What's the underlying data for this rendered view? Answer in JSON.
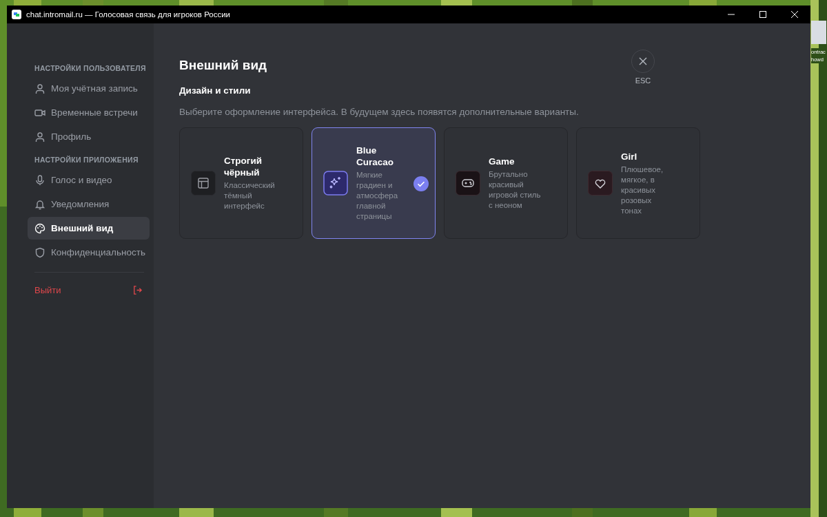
{
  "desktop": {
    "icon": {
      "label": "ontrac howd"
    }
  },
  "window": {
    "title": "chat.intromail.ru — Голосовая связь для игроков России"
  },
  "sidebar": {
    "sections": [
      {
        "heading": "НАСТРОЙКИ ПОЛЬЗОВАТЕЛЯ",
        "items": [
          {
            "label": "Моя учётная запись",
            "selected": false
          },
          {
            "label": "Временные встречи",
            "selected": false
          },
          {
            "label": "Профиль",
            "selected": false
          }
        ]
      },
      {
        "heading": "НАСТРОЙКИ ПРИЛОЖЕНИЯ",
        "items": [
          {
            "label": "Голос и видео",
            "selected": false
          },
          {
            "label": "Уведомления",
            "selected": false
          },
          {
            "label": "Внешний вид",
            "selected": true
          },
          {
            "label": "Конфиденциальность",
            "selected": false
          }
        ]
      }
    ],
    "logout": "Выйти"
  },
  "page": {
    "title": "Внешний вид",
    "subtitle": "Дизайн и стили",
    "description": "Выберите оформление интерфейса. В будущем здесь появятся дополнительные варианты.",
    "close_hint": "ESC",
    "themes": [
      {
        "name": "Строгий чёрный",
        "description": "Классический тёмный интерфейс",
        "selected": false
      },
      {
        "name": "Blue Curacao",
        "description": "Мягкие градиен и атмосфера главной страницы",
        "selected": true
      },
      {
        "name": "Game",
        "description": "Брутально красивый игровой стиль с неоном",
        "selected": false
      },
      {
        "name": "Girl",
        "description": "Плюшевое, мягкое, в красивых розовых тонах",
        "selected": false
      }
    ]
  }
}
